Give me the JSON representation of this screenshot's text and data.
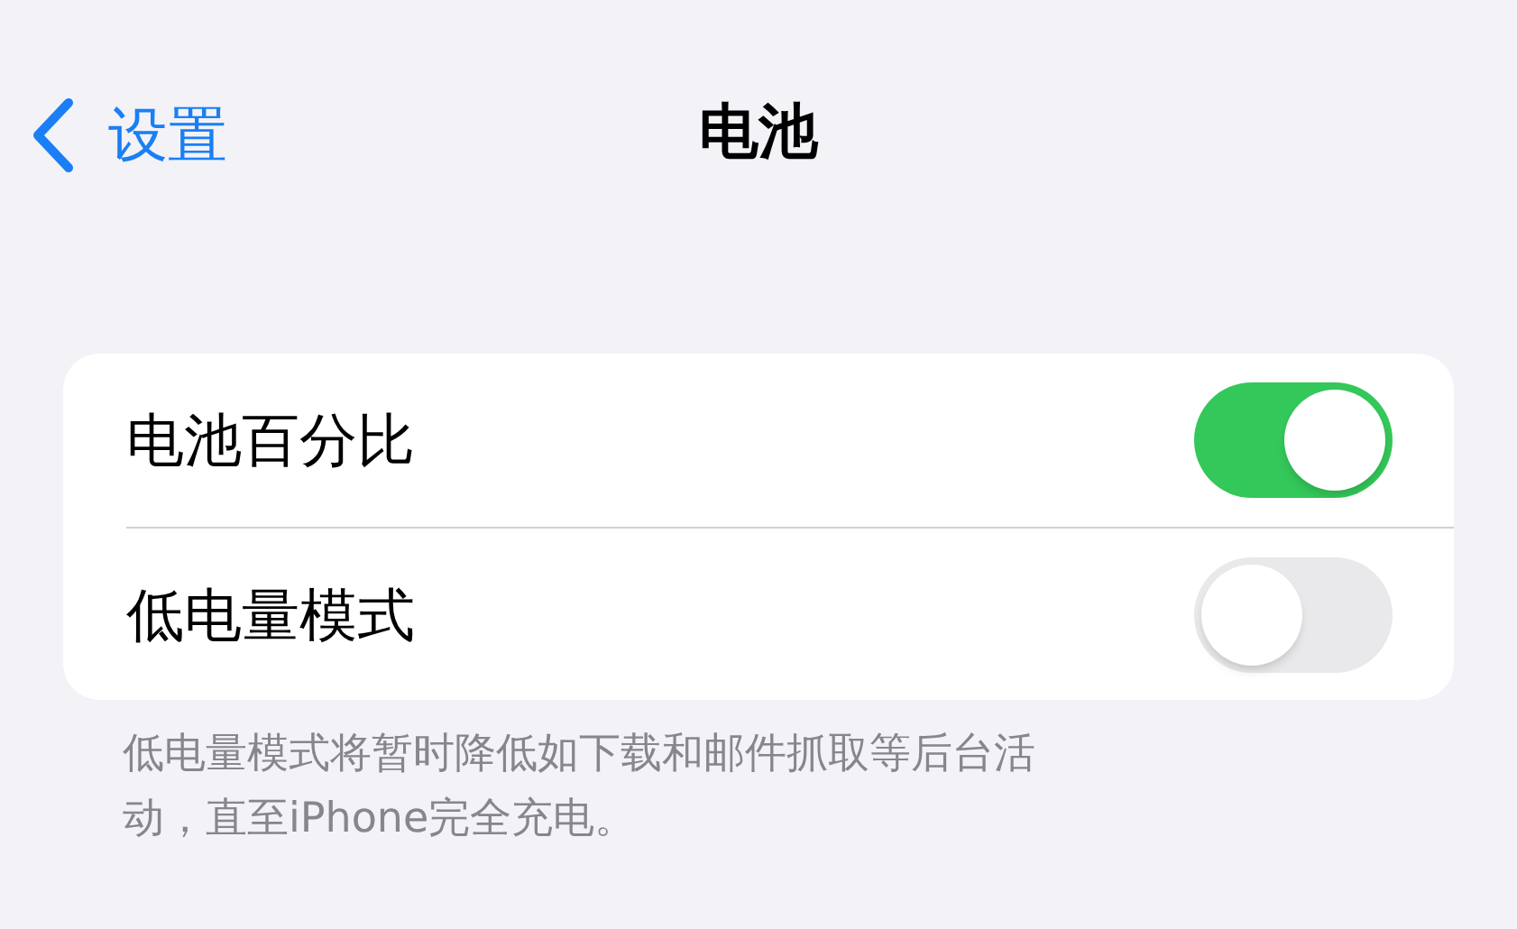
{
  "nav": {
    "back_label": "设置",
    "title": "电池"
  },
  "rows": [
    {
      "label": "电池百分比",
      "on": true
    },
    {
      "label": "低电量模式",
      "on": false
    }
  ],
  "footer": "低电量模式将暂时降低如下载和邮件抓取等后台活动，直至iPhone完全充电。"
}
